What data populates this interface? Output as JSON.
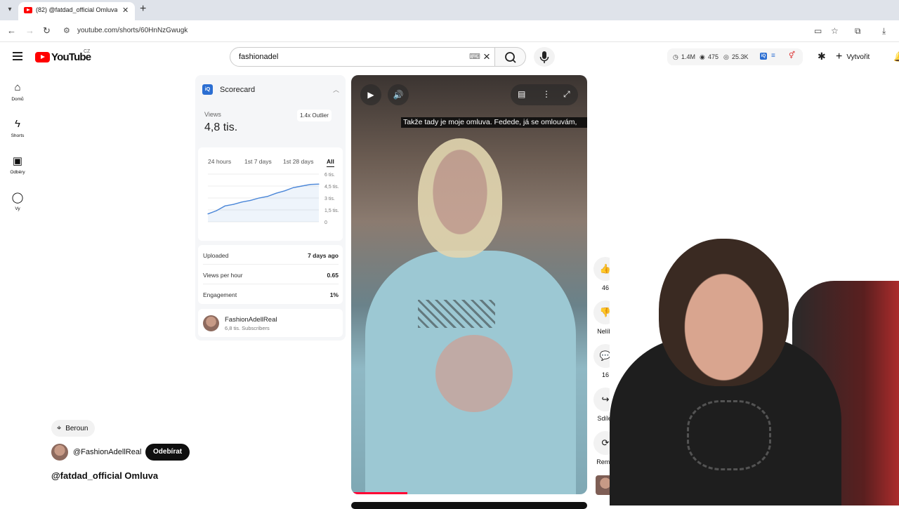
{
  "browser": {
    "tab_title": "(82) @fatdad_official Omluva -",
    "url": "youtube.com/shorts/60HnNzGwugk"
  },
  "header": {
    "logo_text": "YouTube",
    "logo_region": "CZ",
    "search_value": "fashionadel",
    "stats": {
      "views": "1.4M",
      "watching": "475",
      "viewers": "25.3K"
    },
    "create_label": "Vytvořit"
  },
  "sidebar": {
    "items": [
      {
        "label": "Domů",
        "icon": "home-icon"
      },
      {
        "label": "Shorts",
        "icon": "shorts-icon"
      },
      {
        "label": "Odběry",
        "icon": "subscriptions-icon"
      },
      {
        "label": "Vy",
        "icon": "account-icon"
      }
    ]
  },
  "scorecard": {
    "title": "Scorecard",
    "views_label": "Views",
    "views_value": "4,8 tis.",
    "outlier": "1.4x Outlier",
    "tabs": [
      "24 hours",
      "1st 7 days",
      "1st 28 days",
      "All"
    ],
    "active_tab": "All",
    "chart_y_ticks": [
      "6 tis.",
      "4,5 tis.",
      "3 tis.",
      "1,5 tis.",
      "0"
    ],
    "rows": [
      {
        "label": "Uploaded",
        "value": "7 days ago"
      },
      {
        "label": "Views per hour",
        "value": "0.65"
      },
      {
        "label": "Engagement",
        "value": "1%"
      }
    ],
    "channel_name": "FashionAdellReal",
    "channel_subs": "6,8 tis. Subscribers"
  },
  "video": {
    "caption": "Takže tady je moje omluva. Fedede, já se omlouvám,"
  },
  "actions": {
    "like_count": "46",
    "dislike_label": "Nelíbí",
    "comments_count": "16",
    "share_label": "Sdílet",
    "remix_label": "Remix"
  },
  "meta": {
    "location": "Beroun",
    "channel_handle": "@FashionAdellReal",
    "subscribe_label": "Odebírat",
    "video_title": "@fatdad_official Omluva"
  },
  "chart_data": {
    "type": "line",
    "ylim": [
      0,
      6000
    ],
    "ytick_labels": [
      "0",
      "1,5 tis.",
      "3 tis.",
      "4,5 tis.",
      "6 tis."
    ],
    "values": [
      1000,
      1400,
      2000,
      2200,
      2500,
      2700,
      3000,
      3200,
      3600,
      3900,
      4300,
      4500,
      4700,
      4750
    ],
    "xlabel": "",
    "ylabel": "",
    "grid": true
  }
}
